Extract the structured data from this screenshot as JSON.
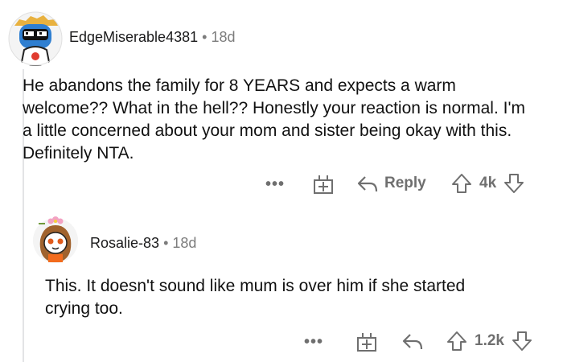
{
  "comments": [
    {
      "username": "EdgeMiserable4381",
      "separator": "•",
      "age": "18d",
      "text": "He abandons the family for 8 YEARS and expects a warm welcome?? What in the hell?? Honestly your reaction is normal. I'm a little concerned about your mom and sister being okay with this. Definitely NTA.",
      "actions": {
        "more": "•••",
        "reply_label": "Reply",
        "votes": "4k"
      },
      "avatar_icon": "robot-avatar-icon"
    },
    {
      "username": "Rosalie-83",
      "separator": "•",
      "age": "18d",
      "text": "This. It doesn't sound like mum is over him if she started crying too.",
      "actions": {
        "more": "•••",
        "votes": "1.2k"
      },
      "avatar_icon": "girl-flower-avatar-icon"
    }
  ],
  "colors": {
    "text": "#1a1a1b",
    "muted": "#7c7c7c",
    "icon": "#6f6f6f",
    "thread_line": "#e3e4e6"
  }
}
